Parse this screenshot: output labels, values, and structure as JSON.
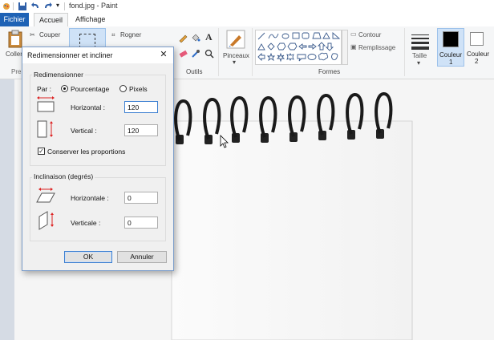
{
  "window": {
    "title": "fond.jpg - Paint"
  },
  "tabs": {
    "file": "Fichier",
    "home": "Accueil",
    "view": "Affichage"
  },
  "ribbon": {
    "paste": "Coller",
    "cut": "Couper",
    "crop": "Rogner",
    "tools_group": "Outils",
    "brushes": "Pinceaux",
    "shapes_group": "Formes",
    "outline": "Contour",
    "fill": "Remplissage",
    "size": "Taille",
    "color1_a": "Couleur",
    "color1_b": "1",
    "color2_a": "Couleur",
    "color2_b": "2",
    "clipboard_trunc": "Pre",
    "colors": {
      "color1": "#000000",
      "color2": "#ffffff",
      "accent": "#1e62b5"
    }
  },
  "dialog": {
    "title": "Redimensionner et incliner",
    "resize_group": "Redimensionner",
    "by_label": "Par :",
    "percent": "Pourcentage",
    "pixels": "Pixels",
    "horizontal": "Horizontal :",
    "horizontal_value": "120",
    "vertical": "Vertical :",
    "vertical_value": "120",
    "keep_ratio": "Conserver les proportions",
    "skew_group": "Inclinaison (degrés)",
    "skew_h": "Horizontale :",
    "skew_h_value": "0",
    "skew_v": "Verticale :",
    "skew_v_value": "0",
    "ok": "OK",
    "cancel": "Annuler"
  }
}
